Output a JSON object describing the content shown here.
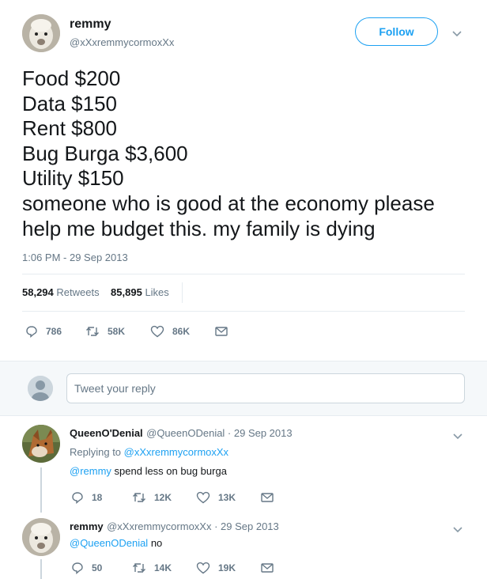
{
  "tweet": {
    "author_name": "remmy",
    "author_handle": "@xXxremmycormoxXx",
    "follow_label": "Follow",
    "text_lines": [
      "Food $200",
      "Data $150",
      "Rent $800",
      "Bug Burga $3,600",
      "Utility $150",
      "someone who is good at the economy please",
      "help me budget this. my family is dying"
    ],
    "timestamp": "1:06 PM - 29 Sep 2013",
    "retweets_count": "58,294",
    "retweets_label": "Retweets",
    "likes_count": "85,895",
    "likes_label": "Likes",
    "actions": {
      "reply": "786",
      "retweet": "58K",
      "like": "86K"
    }
  },
  "reply_box": {
    "placeholder": "Tweet your reply"
  },
  "replies": [
    {
      "name": "QueenO'Denial",
      "handle_date": "@QueenODenial · 29 Sep 2013",
      "replying_prefix": "Replying to",
      "replying_to": "@xXxremmycormoxXx",
      "mention": "@remmy",
      "text": " spend less on bug burga",
      "actions": {
        "reply": "18",
        "retweet": "12K",
        "like": "13K"
      }
    },
    {
      "name": "remmy",
      "handle_date": "@xXxremmycormoxXx · 29 Sep 2013",
      "mention": "@QueenODenial",
      "text": " no",
      "actions": {
        "reply": "50",
        "retweet": "14K",
        "like": "19K"
      }
    }
  ],
  "colors": {
    "accent": "#1da1f2",
    "muted": "#657786",
    "text": "#14171a"
  }
}
